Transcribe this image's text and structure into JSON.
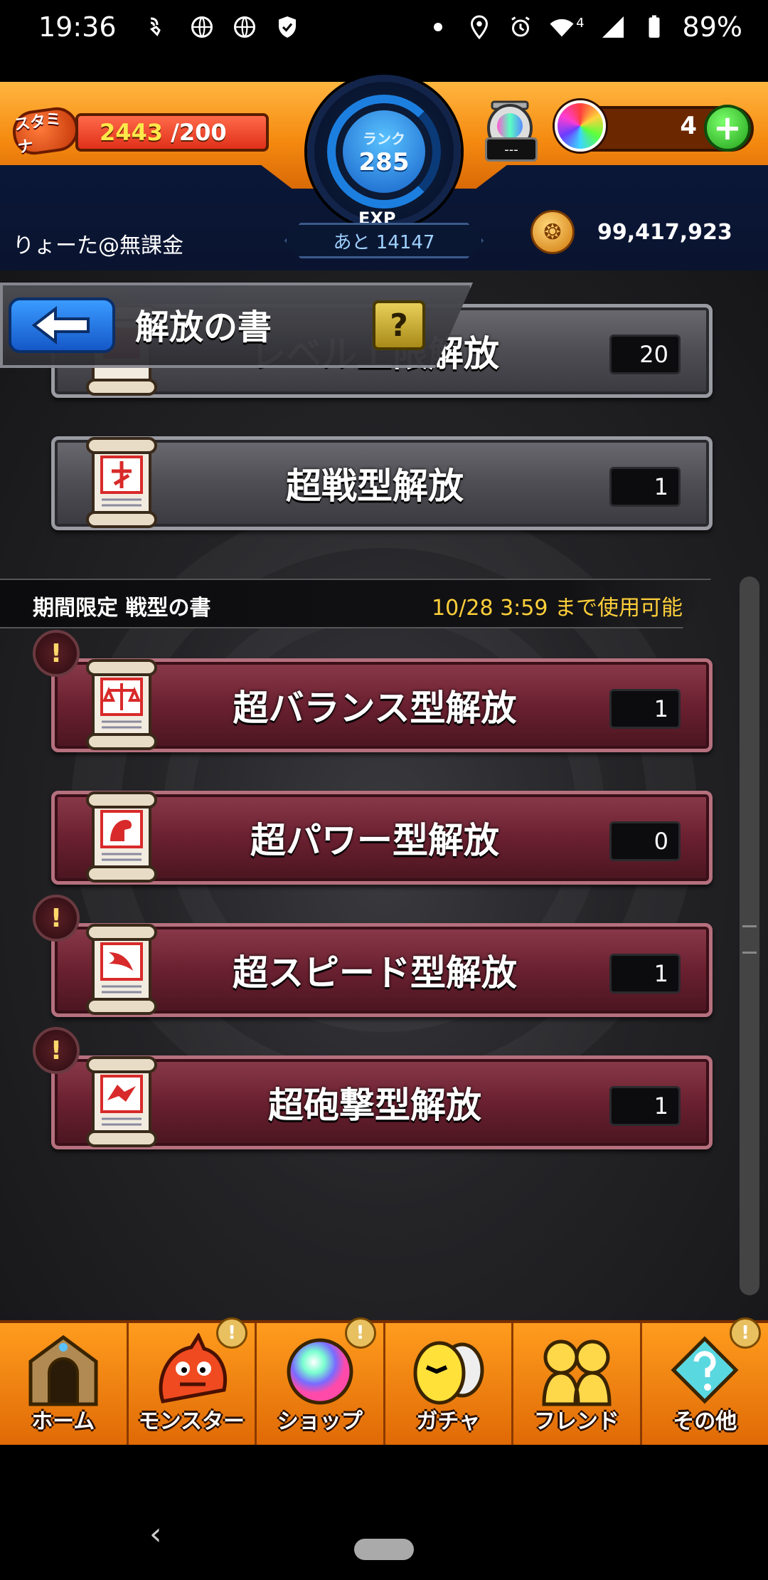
{
  "status_bar": {
    "time": "19:36",
    "battery": "89%",
    "network_badge": "4",
    "icons": [
      "wifi-calling-icon",
      "vpn-globe-icon",
      "vpn-globe-icon",
      "shield-check-icon",
      "dot-icon",
      "location-icon",
      "alarm-icon",
      "wifi-icon",
      "cell-signal-icon",
      "battery-icon"
    ]
  },
  "header": {
    "stamina_label": "スタミナ",
    "stamina_current": "2443",
    "stamina_max": "/200",
    "stamina_fraction": 1.0,
    "rank_label": "ランク",
    "rank_value": "285",
    "exp_label": "EXP",
    "exp_remaining": "あと 14147",
    "egg_counter": "---",
    "orb_count": "4",
    "plus_label": "+",
    "username": "りょーた@無課金",
    "coins": "99,417,923"
  },
  "page": {
    "title": "解放の書",
    "help_label": "?",
    "back_icon": "back-arrow-icon"
  },
  "top_rows": [
    {
      "label": "レベル上限解放",
      "count": "20"
    },
    {
      "label": "超戦型解放",
      "count": "1"
    }
  ],
  "limited_section": {
    "title": "期間限定 戦型の書",
    "note": "10/28 3:59 まで使用可能",
    "alert_mark": "!"
  },
  "limited_rows": [
    {
      "label": "超バランス型解放",
      "count": "1"
    },
    {
      "label": "超パワー型解放",
      "count": "0"
    },
    {
      "label": "超スピード型解放",
      "count": "1"
    },
    {
      "label": "超砲撃型解放",
      "count": "1"
    }
  ],
  "bottom_nav": [
    {
      "label": "ホーム",
      "icon": "home-door-icon"
    },
    {
      "label": "モンスター",
      "icon": "monster-icon"
    },
    {
      "label": "ショップ",
      "icon": "orb-shop-icon"
    },
    {
      "label": "ガチャ",
      "icon": "gacha-egg-icon"
    },
    {
      "label": "フレンド",
      "icon": "friends-icon"
    },
    {
      "label": "その他",
      "icon": "other-menu-icon"
    }
  ],
  "nav_badge": "!"
}
